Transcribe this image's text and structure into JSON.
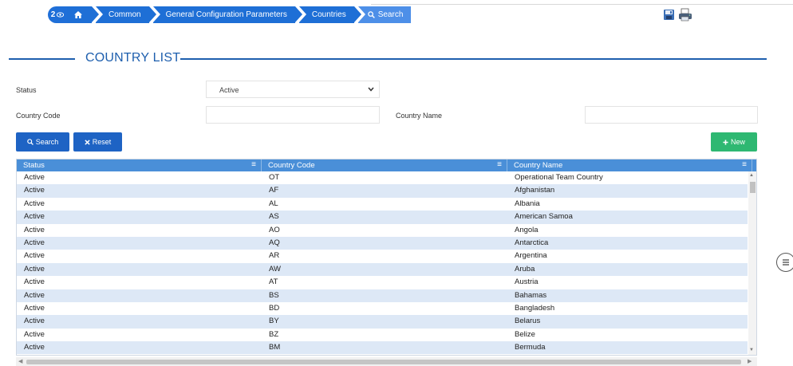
{
  "breadcrumb": {
    "badge_count": "2",
    "items": [
      "Common",
      "General Configuration Parameters",
      "Countries",
      "Search"
    ]
  },
  "page": {
    "title": "COUNTRY LIST"
  },
  "form": {
    "status_label": "Status",
    "status_value": "Active",
    "country_code_label": "Country Code",
    "country_code_value": "",
    "country_name_label": "Country Name",
    "country_name_value": ""
  },
  "buttons": {
    "search": "Search",
    "reset": "Reset",
    "new": "New"
  },
  "grid": {
    "columns": [
      "Status",
      "Country Code",
      "Country Name"
    ],
    "rows": [
      [
        "Active",
        "OT",
        "Operational Team Country"
      ],
      [
        "Active",
        "AF",
        "Afghanistan"
      ],
      [
        "Active",
        "AL",
        "Albania"
      ],
      [
        "Active",
        "AS",
        "American Samoa"
      ],
      [
        "Active",
        "AO",
        "Angola"
      ],
      [
        "Active",
        "AQ",
        "Antarctica"
      ],
      [
        "Active",
        "AR",
        "Argentina"
      ],
      [
        "Active",
        "AW",
        "Aruba"
      ],
      [
        "Active",
        "AT",
        "Austria"
      ],
      [
        "Active",
        "BS",
        "Bahamas"
      ],
      [
        "Active",
        "BD",
        "Bangladesh"
      ],
      [
        "Active",
        "BY",
        "Belarus"
      ],
      [
        "Active",
        "BZ",
        "Belize"
      ],
      [
        "Active",
        "BM",
        "Bermuda"
      ]
    ]
  },
  "colors": {
    "primary": "#1e63c4",
    "header": "#4a8fd8",
    "title": "#1e5fae",
    "new_button": "#2eb872",
    "alt_row": "#dde8f6"
  }
}
